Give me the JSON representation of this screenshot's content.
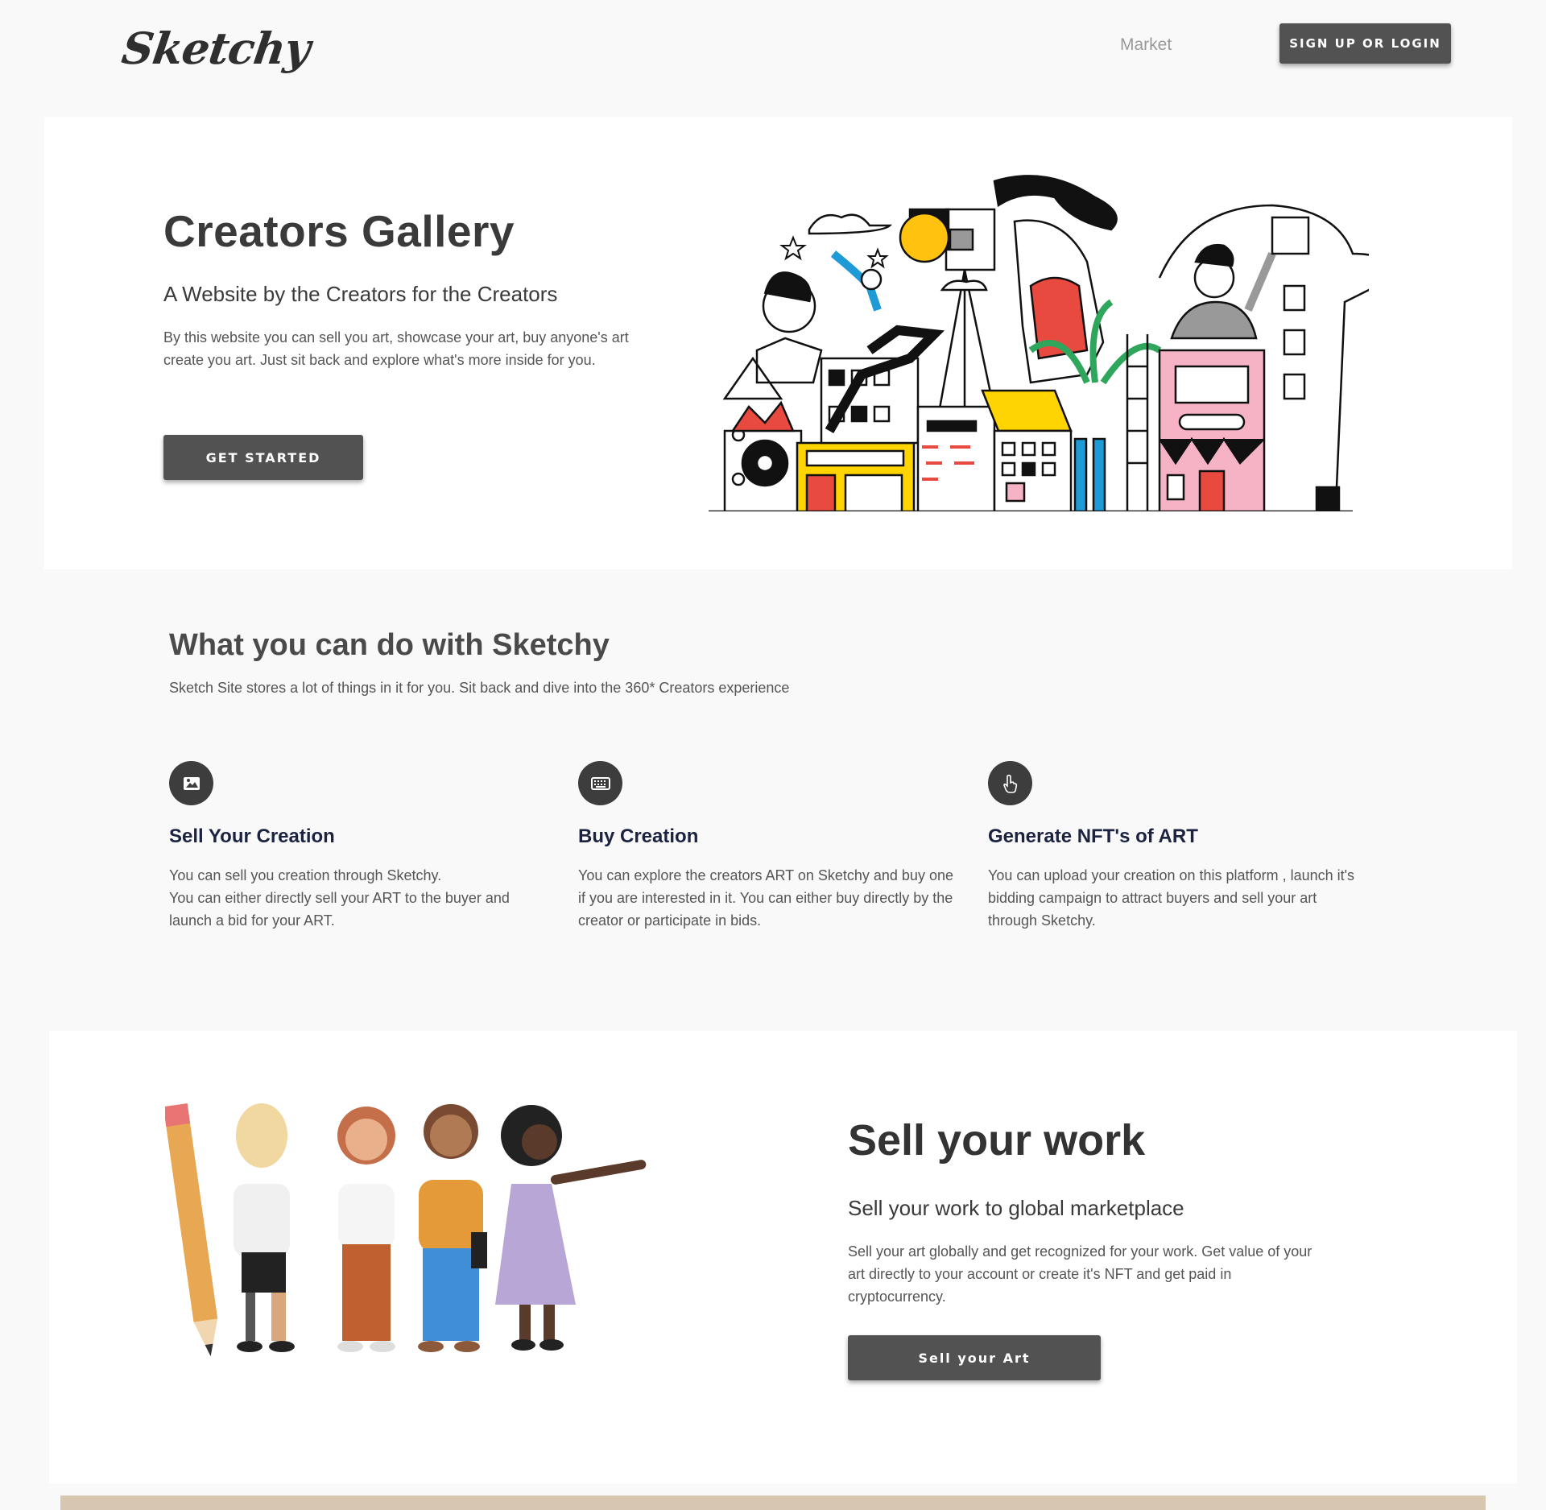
{
  "nav": {
    "logo": "Sketchy",
    "market_link": "Market",
    "signup_button": "SIGN UP OR LOGIN"
  },
  "hero": {
    "title": "Creators Gallery",
    "subtitle": "A Website by the Creators for the Creators",
    "description": "By this website you can sell you art, showcase your art, buy anyone's art create you art.  Just sit back and explore what's more inside for you.",
    "cta_button": "GET STARTED"
  },
  "features_section": {
    "title": "What you can do with Sketchy",
    "subtitle": "Sketch Site stores a lot of things in it for you. Sit back and dive into the 360* Creators experience",
    "items": [
      {
        "icon": "image-icon",
        "title": "Sell Your Creation",
        "description": "You can sell you creation through Sketchy.\nYou can either directly sell your ART to the buyer and launch a bid for your ART."
      },
      {
        "icon": "keyboard-icon",
        "title": "Buy Creation",
        "description": "You can explore the creators ART on Sketchy and buy one if you are interested in it. You can either buy directly by the creator or participate in bids."
      },
      {
        "icon": "pointer-hand-icon",
        "title": "Generate NFT's of ART",
        "description": "You can upload your creation on this platform , launch it's bidding campaign to attract buyers and sell your art through Sketchy."
      }
    ]
  },
  "sell_section": {
    "title": "Sell your work",
    "subtitle": "Sell your work to global marketplace",
    "description": "Sell your art globally and get recognized for your work. Get value of your art directly to your account or create it's NFT and get paid in cryptocurrency.",
    "cta_button": "Sell your Art"
  },
  "colors": {
    "background": "#f9f9f9",
    "button_dark": "#525252",
    "feature_title": "#1b2340",
    "icon_circle": "#3d3d3d",
    "accent_yellow": "#ffd400",
    "accent_pink": "#f7b3c6",
    "accent_red": "#e84a3f",
    "accent_blue": "#1e9ad6"
  }
}
